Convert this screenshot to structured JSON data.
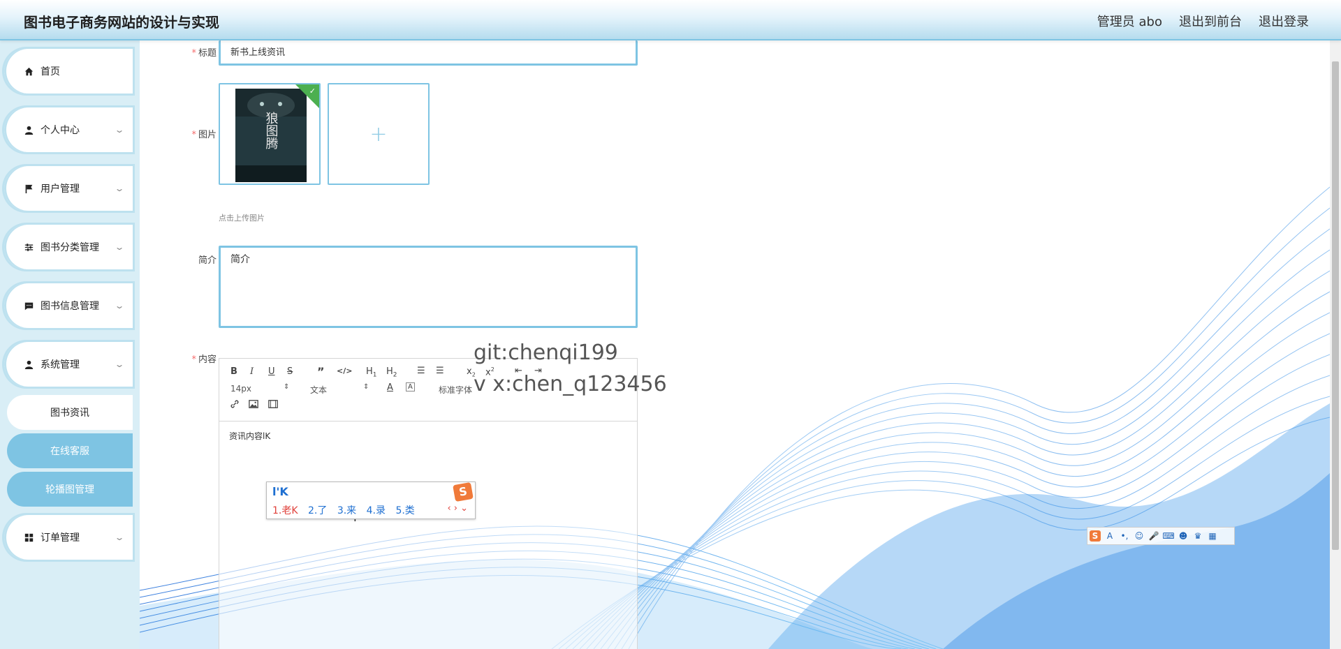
{
  "header": {
    "title": "图书电子商务网站的设计与实现",
    "user": "管理员 abo",
    "back_front": "退出到前台",
    "logout": "退出登录"
  },
  "sidebar": {
    "items": [
      {
        "label": "首页",
        "icon": "home-icon"
      },
      {
        "label": "个人中心",
        "icon": "user-icon"
      },
      {
        "label": "用户管理",
        "icon": "flag-icon"
      },
      {
        "label": "图书分类管理",
        "icon": "sliders-icon"
      },
      {
        "label": "图书信息管理",
        "icon": "chat-icon"
      },
      {
        "label": "系统管理",
        "icon": "user-icon"
      },
      {
        "label": "订单管理",
        "icon": "grid-icon"
      }
    ],
    "sub_items": [
      "图书资讯",
      "在线客服",
      "轮播图管理"
    ]
  },
  "form": {
    "title_label": "标题",
    "title_value": "新书上线资讯",
    "image_label": "图片",
    "upload_hint": "点击上传图片",
    "book_cover_title": "狼图腾",
    "intro_label": "简介",
    "intro_value": "简介",
    "content_label": "内容",
    "content_value": "资讯内容lK"
  },
  "editor": {
    "font_size": "14px",
    "block_type": "文本",
    "font_family": "标准字体"
  },
  "ime": {
    "composition": "l'K",
    "candidates": [
      "1.老K",
      "2.了",
      "3.来",
      "4.录",
      "5.类"
    ]
  },
  "watermark": {
    "line1": "git:chenqi199",
    "line2": "v x:chen_q123456"
  },
  "colors": {
    "accent": "#7ec4e3",
    "sidebar_bg": "#d9eef6",
    "required": "#f56c6c"
  }
}
